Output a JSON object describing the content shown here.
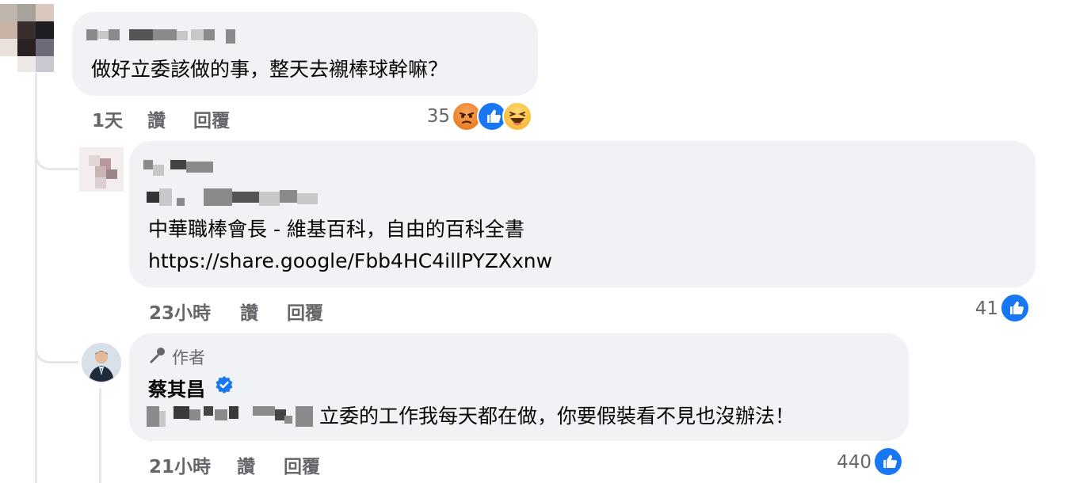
{
  "comment1": {
    "text": "做好立委該做的事，整天去襯棒球幹嘛？",
    "time": "1天",
    "like": "讚",
    "reply": "回覆",
    "reaction_count": "35",
    "reactions": [
      "angry-icon",
      "like-icon",
      "haha-icon"
    ]
  },
  "reply1": {
    "line1": "中華職棒會長 - 維基百科，自由的百科全書",
    "line2": "https://share.google/Fbb4HC4illPYZXxnw",
    "time": "23小時",
    "like": "讚",
    "reply": "回覆",
    "reaction_count": "41",
    "reactions": [
      "like-icon"
    ]
  },
  "reply2": {
    "badge": "作者",
    "author": "蔡其昌",
    "text": "立委的工作我每天都在做，你要假裝看不見也沒辦法！",
    "time": "21小時",
    "like": "讚",
    "reply": "回覆",
    "reaction_count": "440",
    "reactions": [
      "like-icon"
    ]
  },
  "colors": {
    "bubble": "#f0f2f5",
    "meta_text": "#65676b",
    "like_blue": "#1877f2",
    "angry": "#e9710f",
    "haha": "#f7b125",
    "verified": "#1877f2"
  }
}
